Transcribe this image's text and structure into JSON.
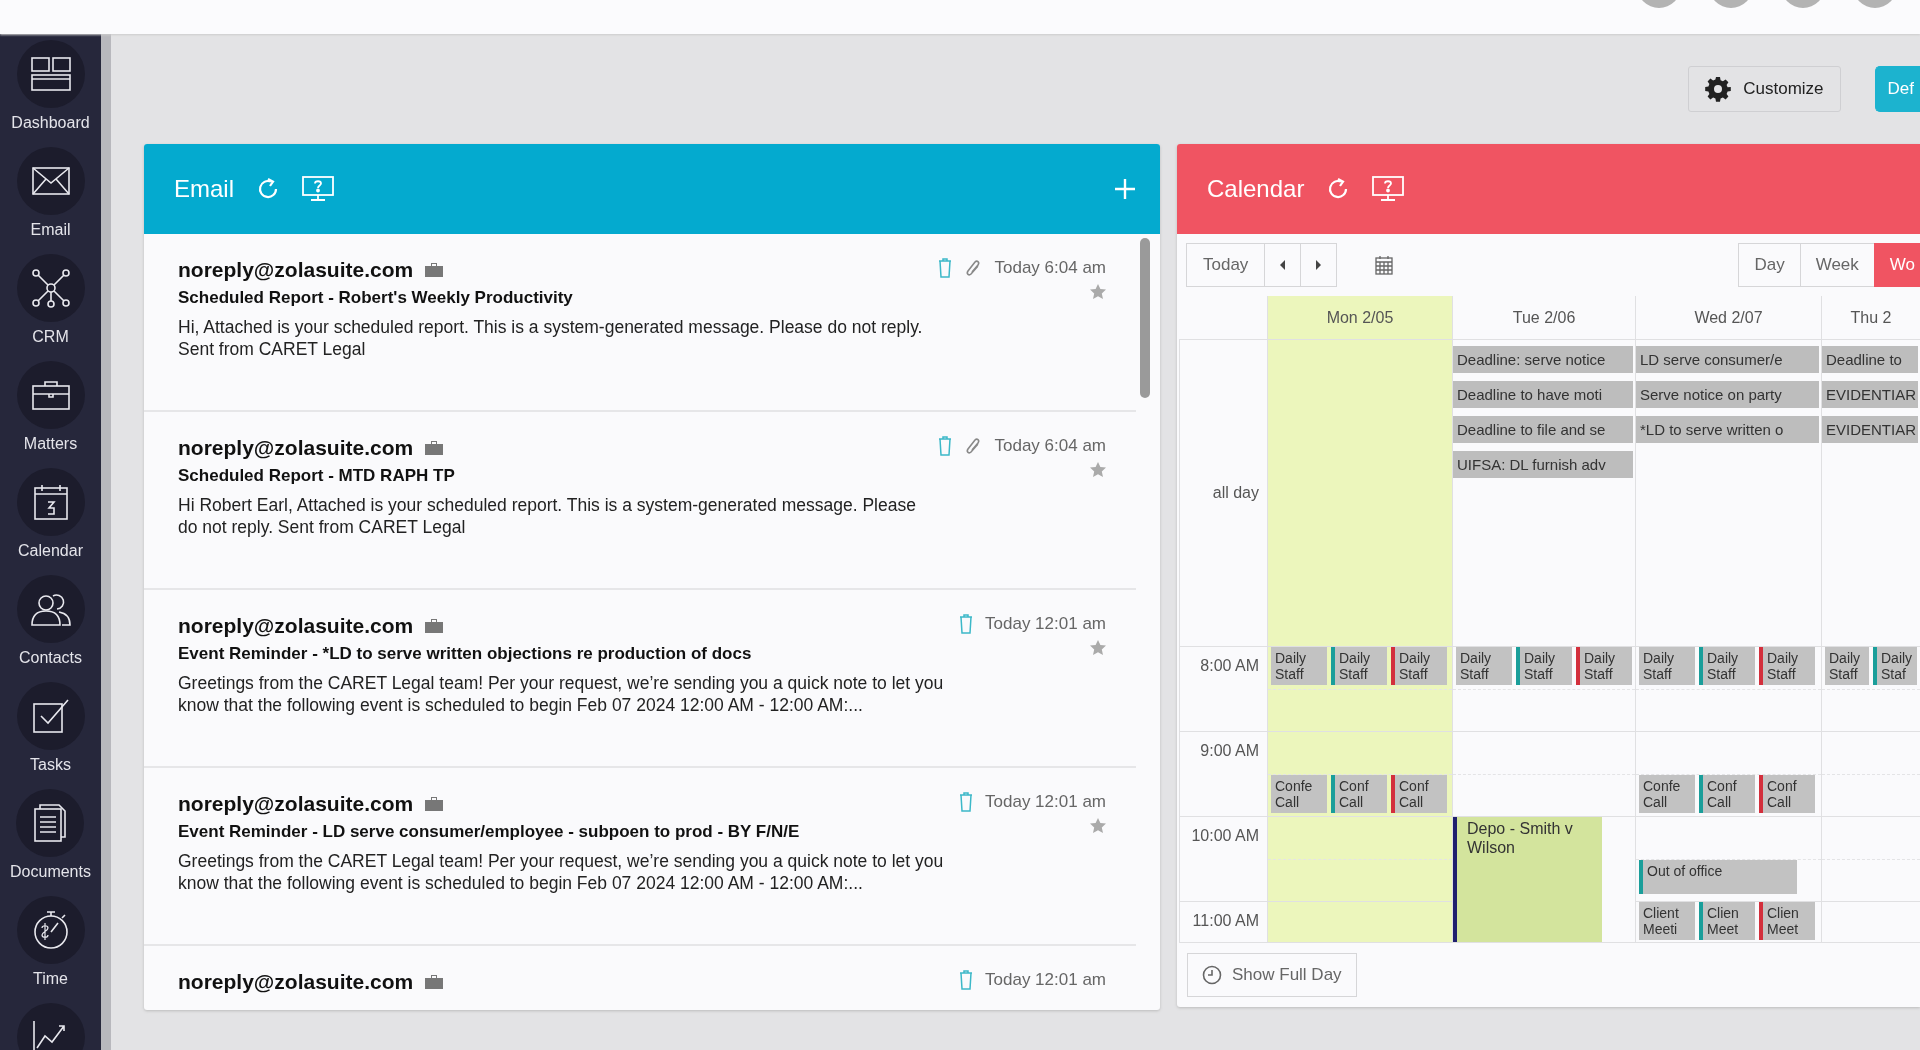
{
  "sidebar": {
    "items": [
      {
        "label": "Dashboard"
      },
      {
        "label": "Email"
      },
      {
        "label": "CRM"
      },
      {
        "label": "Matters"
      },
      {
        "label": "Calendar"
      },
      {
        "label": "Contacts"
      },
      {
        "label": "Tasks"
      },
      {
        "label": "Documents"
      },
      {
        "label": "Time"
      }
    ]
  },
  "toolbar": {
    "customize_button": "Customize",
    "primary_button": "Def"
  },
  "email": {
    "title": "Email",
    "messages": [
      {
        "sender": "noreply@zolasuite.com",
        "subject": "Scheduled Report - Robert's Weekly Productivity",
        "preview": "Hi, Attached is your scheduled report. This is a system-generated message. Please do not reply. Sent from CARET Legal",
        "time": "Today 6:04 am",
        "attachment": true
      },
      {
        "sender": "noreply@zolasuite.com",
        "subject": "Scheduled Report - MTD RAPH TP",
        "preview": "Hi Robert Earl, Attached is your scheduled report. This is a system-generated message. Please do not reply. Sent from CARET Legal",
        "time": "Today 6:04 am",
        "attachment": true
      },
      {
        "sender": "noreply@zolasuite.com",
        "subject": "Event Reminder - *LD to serve written objections re production of docs",
        "preview": "Greetings from the CARET Legal team! Per your request, we’re sending you a quick note to let you know that the following event is scheduled to begin Feb 07 2024 12:00 AM - 12:00 AM:...",
        "time": "Today 12:01 am",
        "attachment": false
      },
      {
        "sender": "noreply@zolasuite.com",
        "subject": "Event Reminder - LD serve consumer/employee - subpoen to prod - BY F/N/E",
        "preview": "Greetings from the CARET Legal team! Per your request, we’re sending you a quick note to let you know that the following event is scheduled to begin Feb 07 2024 12:00 AM - 12:00 AM:...",
        "time": "Today 12:01 am",
        "attachment": false
      },
      {
        "sender": "noreply@zolasuite.com",
        "time": "Today 12:01 am",
        "attachment": false
      }
    ]
  },
  "calendar": {
    "title": "Calendar",
    "today_button": "Today",
    "views": [
      {
        "label": "Day",
        "selected": false
      },
      {
        "label": "Week",
        "selected": false
      },
      {
        "label": "Wo",
        "selected": true
      }
    ],
    "all_day_label": "all day",
    "days": [
      {
        "label": "Mon 2/05",
        "today": true
      },
      {
        "label": "Tue 2/06",
        "today": false,
        "all_day": [
          "Deadline: serve notice",
          "Deadline to have moti",
          "Deadline to file and se",
          "UIFSA: DL furnish adv"
        ]
      },
      {
        "label": "Wed 2/07",
        "today": false,
        "all_day": [
          "LD serve consumer/e",
          "Serve notice on party",
          "*LD to serve written o"
        ]
      },
      {
        "label": "Thu 2",
        "today": false,
        "all_day": [
          "Deadline to",
          "EVIDENTIAR",
          "EVIDENTIAR"
        ]
      }
    ],
    "hours": [
      {
        "label": "8:00 AM",
        "cells": [
          [
            {
              "text": "Daily Staff",
              "kind": "early"
            },
            {
              "text": "Daily Staff",
              "kind": "early",
              "color": "#1a9e9a"
            },
            {
              "text": "Daily Staff",
              "kind": "early",
              "color": "#d32f3c"
            }
          ],
          [
            {
              "text": "Daily Staff",
              "kind": "early"
            },
            {
              "text": "Daily Staff",
              "kind": "early",
              "color": "#1a9e9a"
            },
            {
              "text": "Daily Staff",
              "kind": "early",
              "color": "#d32f3c"
            }
          ],
          [
            {
              "text": "Daily Staff",
              "kind": "early"
            },
            {
              "text": "Daily Staff",
              "kind": "early",
              "color": "#1a9e9a"
            },
            {
              "text": "Daily Staff",
              "kind": "early",
              "color": "#d32f3c"
            }
          ],
          [
            {
              "text": "Daily Staff",
              "kind": "early"
            },
            {
              "text": "Daily Staf",
              "kind": "early",
              "color": "#1a9e9a"
            }
          ]
        ]
      },
      {
        "label": "9:00 AM",
        "cells": [
          [
            {
              "text": "Confe Call",
              "kind": "late"
            },
            {
              "text": "Conf Call",
              "kind": "late",
              "color": "#1a9e9a"
            },
            {
              "text": "Conf Call",
              "kind": "late",
              "color": "#d32f3c"
            }
          ],
          [],
          [
            {
              "text": "Confe Call",
              "kind": "late"
            },
            {
              "text": "Conf Call",
              "kind": "late",
              "color": "#1a9e9a"
            },
            {
              "text": "Conf Call",
              "kind": "late",
              "color": "#d32f3c"
            }
          ],
          []
        ]
      },
      {
        "label": "10:00 AM",
        "cells": [
          [],
          [
            {
              "text": "Depo - Smith v Wilson",
              "kind": "block",
              "color": "#1f1f6e"
            }
          ],
          [
            {
              "text": "Out of office",
              "kind": "late",
              "color": "#1a9e9a"
            }
          ],
          []
        ]
      },
      {
        "label": "11:00 AM",
        "cells": [
          [],
          [],
          [
            {
              "text": "Client Meeti",
              "kind": "early"
            },
            {
              "text": "Clien Meet",
              "kind": "early",
              "color": "#1a9e9a"
            },
            {
              "text": "Clien Meet",
              "kind": "early",
              "color": "#d32f3c"
            }
          ],
          []
        ]
      }
    ],
    "show_full_day_button": "Show Full Day"
  }
}
